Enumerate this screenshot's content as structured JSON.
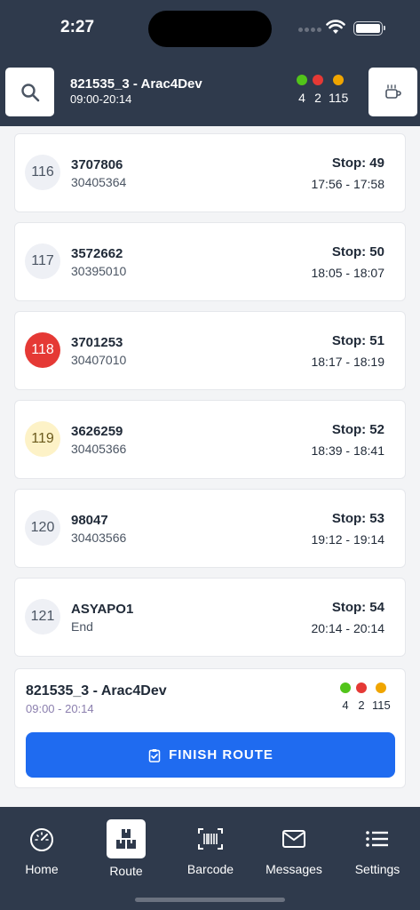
{
  "status_bar": {
    "time": "2:27"
  },
  "header": {
    "route_title": "821535_3 - Arac4Dev",
    "route_time": "09:00-20:14",
    "counts": [
      {
        "color": "#52c41a",
        "value": "4"
      },
      {
        "color": "#e53935",
        "value": "2"
      },
      {
        "color": "#f0a500",
        "value": "115"
      }
    ]
  },
  "stops": [
    {
      "seq": "116",
      "order": "3707806",
      "ref": "30405364",
      "stop": "Stop: 49",
      "window": "17:56 - 17:58",
      "badge": "default"
    },
    {
      "seq": "117",
      "order": "3572662",
      "ref": "30395010",
      "stop": "Stop: 50",
      "window": "18:05 - 18:07",
      "badge": "default"
    },
    {
      "seq": "118",
      "order": "3701253",
      "ref": "30407010",
      "stop": "Stop: 51",
      "window": "18:17 - 18:19",
      "badge": "red"
    },
    {
      "seq": "119",
      "order": "3626259",
      "ref": "30405366",
      "stop": "Stop: 52",
      "window": "18:39 - 18:41",
      "badge": "yellow"
    },
    {
      "seq": "120",
      "order": "98047",
      "ref": "30403566",
      "stop": "Stop: 53",
      "window": "19:12 - 19:14",
      "badge": "default"
    },
    {
      "seq": "121",
      "order": "ASYAPO1",
      "ref": "End",
      "stop": "Stop: 54",
      "window": "20:14 - 20:14",
      "badge": "default"
    }
  ],
  "summary": {
    "title": "821535_3 - Arac4Dev",
    "time": "09:00 - 20:14",
    "counts": [
      "4",
      "2",
      "115"
    ],
    "finish_label": "FINISH ROUTE"
  },
  "nav": {
    "home": "Home",
    "route": "Route",
    "barcode": "Barcode",
    "messages": "Messages",
    "settings": "Settings"
  }
}
